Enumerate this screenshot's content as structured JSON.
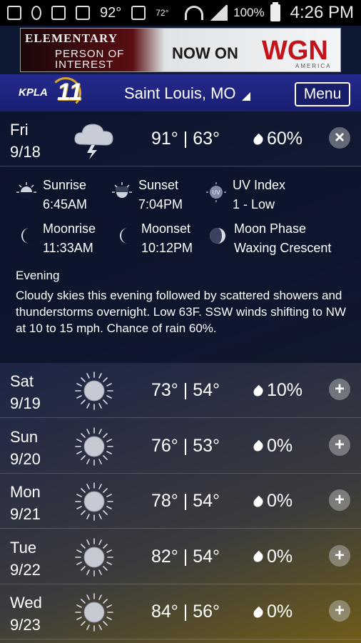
{
  "statusbar": {
    "temp": "92°",
    "small_temp": "72°",
    "battery": "100%",
    "time": "4:26 PM"
  },
  "ad": {
    "show_line1": "ELEMENTARY",
    "show_line2": "PERSON OF INTEREST",
    "now_on": "NOW ON",
    "brand": "WGN",
    "brand_sub": "AMERICA"
  },
  "header": {
    "logo_text": "KPLA",
    "logo_num": "11",
    "location": "Saint Louis, MO",
    "menu_label": "Menu"
  },
  "today": {
    "day": "Fri",
    "date": "9/18",
    "icon": "cloud-lightning-icon",
    "temps": "91° | 63°",
    "precip": "60%",
    "toggle": "×",
    "details": {
      "sunrise_label": "Sunrise",
      "sunrise_value": "6:45AM",
      "sunset_label": "Sunset",
      "sunset_value": "7:04PM",
      "uv_label": "UV Index",
      "uv_value": "1 - Low",
      "moonrise_label": "Moonrise",
      "moonrise_value": "11:33AM",
      "moonset_label": "Moonset",
      "moonset_value": "10:12PM",
      "moonphase_label": "Moon Phase",
      "moonphase_value": "Waxing Crescent",
      "evening_title": "Evening",
      "evening_text": "Cloudy skies this evening followed by scattered showers and thunderstorms overnight. Low 63F. SSW winds shifting to NW at 10 to 15 mph. Chance of rain 60%."
    }
  },
  "forecast": [
    {
      "day": "Sat",
      "date": "9/19",
      "icon": "sun-icon",
      "temps": "73° | 54°",
      "precip": "10%",
      "toggle": "+"
    },
    {
      "day": "Sun",
      "date": "9/20",
      "icon": "sun-icon",
      "temps": "76° | 53°",
      "precip": "0%",
      "toggle": "+"
    },
    {
      "day": "Mon",
      "date": "9/21",
      "icon": "sun-icon",
      "temps": "78° | 54°",
      "precip": "0%",
      "toggle": "+"
    },
    {
      "day": "Tue",
      "date": "9/22",
      "icon": "sun-icon",
      "temps": "82° | 54°",
      "precip": "0%",
      "toggle": "+"
    },
    {
      "day": "Wed",
      "date": "9/23",
      "icon": "sun-icon",
      "temps": "84° | 56°",
      "precip": "0%",
      "toggle": "+"
    }
  ]
}
